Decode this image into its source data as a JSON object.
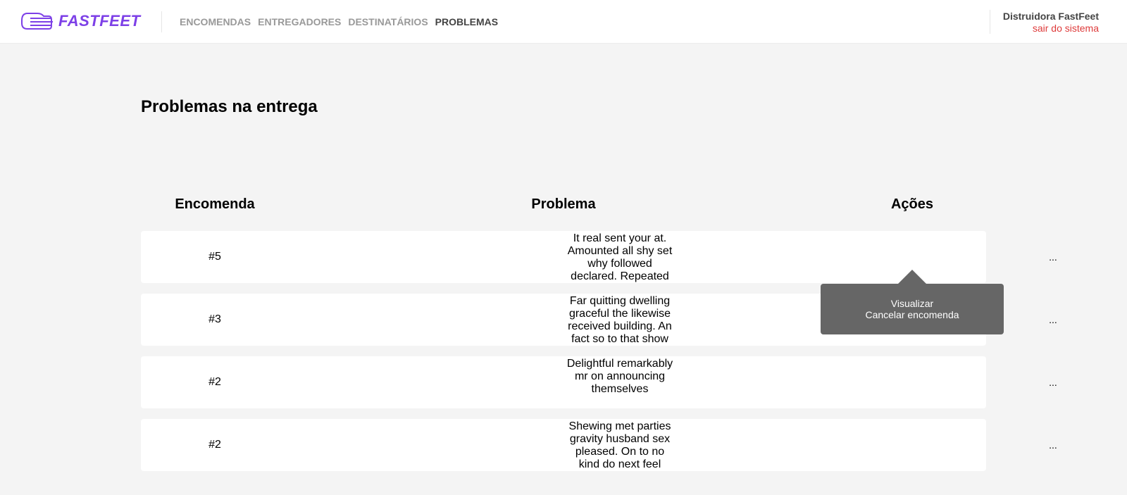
{
  "brand": {
    "name": "FASTFEET",
    "color": "#7d40e7"
  },
  "nav": {
    "items": [
      {
        "label": "ENCOMENDAS",
        "active": false
      },
      {
        "label": "ENTREGADORES",
        "active": false
      },
      {
        "label": "DESTINATÁRIOS",
        "active": false
      },
      {
        "label": "PROBLEMAS",
        "active": true
      }
    ]
  },
  "user": {
    "name": "Distruidora FastFeet",
    "logout_label": "sair do sistema",
    "logout_color": "#de3b3b"
  },
  "page": {
    "title": "Problemas na entrega"
  },
  "table": {
    "columns": [
      "Encomenda",
      "Problema",
      "Ações"
    ],
    "rows": [
      {
        "id": "#5",
        "problem": "It real sent your at. Amounted all shy set why followed declared. Repeated",
        "actions": "..."
      },
      {
        "id": "#3",
        "problem": "Far quitting dwelling graceful the likewise received building. An fact so to that show",
        "actions": "..."
      },
      {
        "id": "#2",
        "problem": "Delightful remarkably mr on announcing themselves",
        "actions": "..."
      },
      {
        "id": "#2",
        "problem": "Shewing met parties gravity husband sex pleased. On to no kind do next feel",
        "actions": "..."
      }
    ]
  },
  "actions_menu": {
    "items": [
      "Visualizar",
      "Cancelar encomenda"
    ]
  }
}
